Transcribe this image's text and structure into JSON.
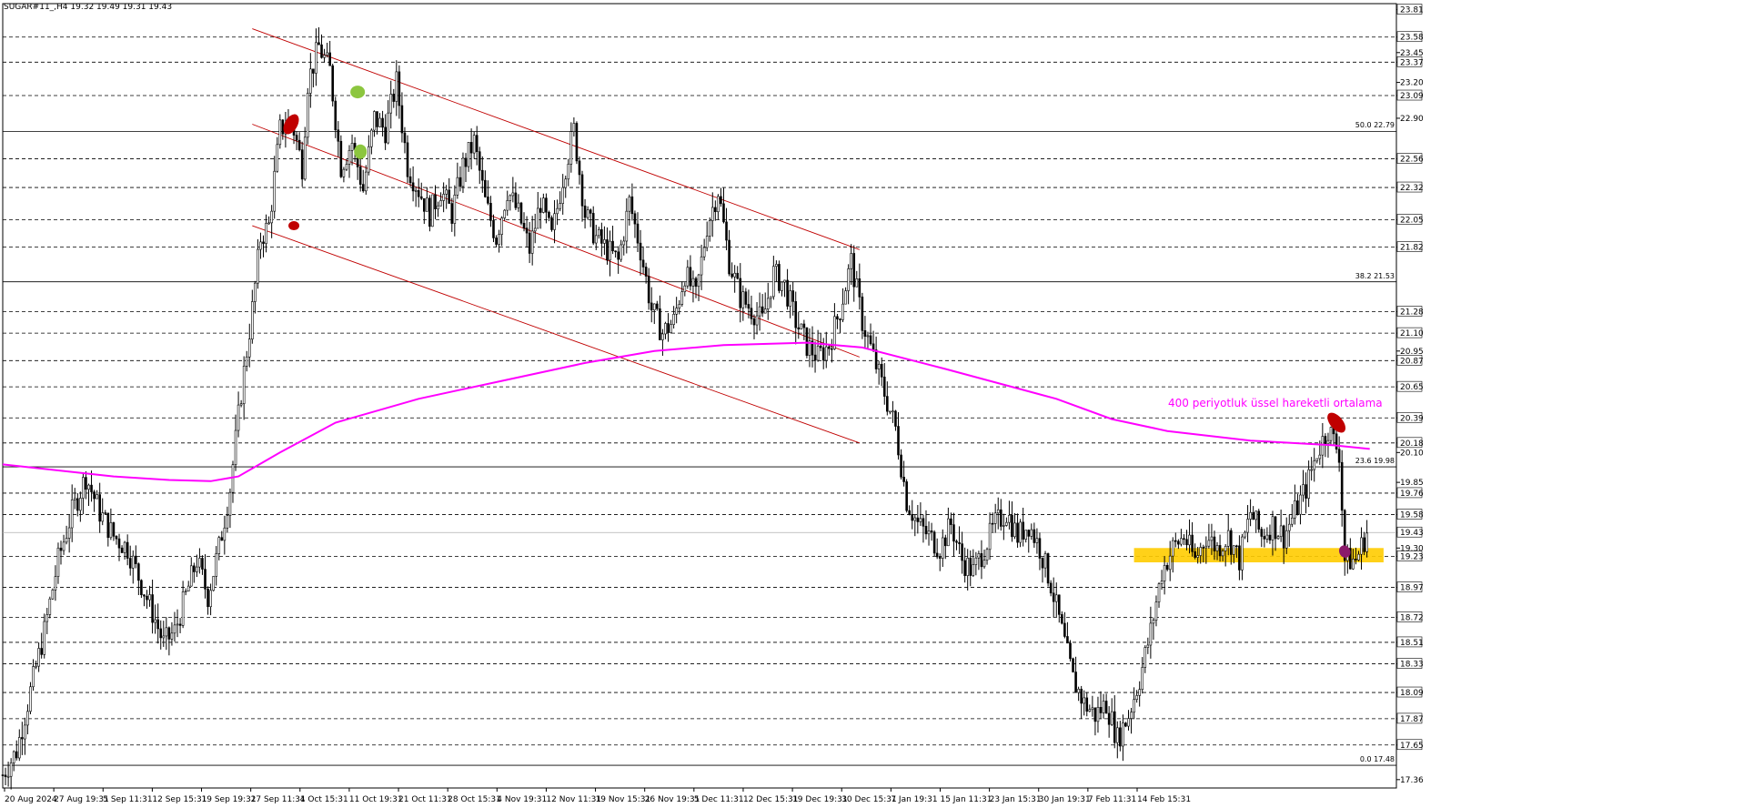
{
  "header": {
    "symbol": "SUGAR#11_,H4",
    "quote": "19.32 19.49 19.31 19.43"
  },
  "annotation": {
    "ma_caption": "400 periyotluk üssel hareketli ortalama"
  },
  "colors": {
    "candle": "#000000",
    "ma": "#ff00ff",
    "channel": "#c00000",
    "zone": "#ffcc00",
    "marker_red": "#c00000",
    "marker_green": "#8cc63f",
    "marker_purple": "#8b1a6b"
  },
  "chart_data": {
    "type": "candlestick",
    "title": "",
    "xlabel": "",
    "ylabel": "",
    "ylim": [
      17.29,
      23.86
    ],
    "grid": false,
    "price_levels": [
      {
        "value": 23.81,
        "label": "23.81",
        "boxed": true
      },
      {
        "value": 23.58,
        "label": "23.58",
        "boxed": true
      },
      {
        "value": 23.45,
        "label": "23.45",
        "boxed": false
      },
      {
        "value": 23.37,
        "label": "23.37",
        "boxed": true
      },
      {
        "value": 23.2,
        "label": "23.20",
        "boxed": false
      },
      {
        "value": 23.09,
        "label": "23.09",
        "boxed": true
      },
      {
        "value": 22.9,
        "label": "22.90",
        "boxed": false
      },
      {
        "value": 22.56,
        "label": "22.56",
        "boxed": true
      },
      {
        "value": 22.32,
        "label": "22.32",
        "boxed": true
      },
      {
        "value": 22.05,
        "label": "22.05",
        "boxed": true
      },
      {
        "value": 21.82,
        "label": "21.82",
        "boxed": true
      },
      {
        "value": 21.28,
        "label": "21.28",
        "boxed": true
      },
      {
        "value": 21.1,
        "label": "21.10",
        "boxed": true
      },
      {
        "value": 20.95,
        "label": "20.95",
        "boxed": false
      },
      {
        "value": 20.87,
        "label": "20.87",
        "boxed": true
      },
      {
        "value": 20.65,
        "label": "20.65",
        "boxed": true
      },
      {
        "value": 20.39,
        "label": "20.39",
        "boxed": true
      },
      {
        "value": 20.18,
        "label": "20.18",
        "boxed": true
      },
      {
        "value": 20.1,
        "label": "20.10",
        "boxed": false
      },
      {
        "value": 19.85,
        "label": "19.85",
        "boxed": false
      },
      {
        "value": 19.76,
        "label": "19.76",
        "boxed": true
      },
      {
        "value": 19.58,
        "label": "19.58",
        "boxed": true
      },
      {
        "value": 19.43,
        "label": "19.43",
        "boxed": true
      },
      {
        "value": 19.3,
        "label": "19.30",
        "boxed": false
      },
      {
        "value": 19.23,
        "label": "19.23",
        "boxed": true
      },
      {
        "value": 18.97,
        "label": "18.97",
        "boxed": true
      },
      {
        "value": 18.72,
        "label": "18.72",
        "boxed": true
      },
      {
        "value": 18.51,
        "label": "18.51",
        "boxed": true
      },
      {
        "value": 18.33,
        "label": "18.33",
        "boxed": true
      },
      {
        "value": 18.09,
        "label": "18.09",
        "boxed": true
      },
      {
        "value": 17.87,
        "label": "17.87",
        "boxed": true
      },
      {
        "value": 17.65,
        "label": "17.65",
        "boxed": true
      },
      {
        "value": 17.36,
        "label": "17.36",
        "boxed": false
      }
    ],
    "dashed_levels": [
      23.58,
      23.37,
      23.09,
      22.56,
      22.32,
      22.05,
      21.82,
      21.28,
      21.1,
      20.87,
      20.65,
      20.39,
      20.18,
      19.76,
      19.58,
      19.23,
      18.97,
      18.72,
      18.51,
      18.33,
      18.09,
      17.87,
      17.65
    ],
    "fibonacci": [
      {
        "label": "50.0 22.79",
        "value": 22.79
      },
      {
        "label": "38.2 21.53",
        "value": 21.53
      },
      {
        "label": "23.6 19.98",
        "value": 19.98
      },
      {
        "label": "0.0 17.48",
        "value": 17.48
      }
    ],
    "current_price": 19.43,
    "time_labels": [
      "20 Aug 2024",
      "27 Aug 19:31",
      "5 Sep 11:31",
      "12 Sep 15:31",
      "19 Sep 19:31",
      "27 Sep 11:31",
      "4 Oct 15:31",
      "11 Oct 19:31",
      "21 Oct 11:31",
      "28 Oct 15:31",
      "4 Nov 19:31",
      "12 Nov 11:31",
      "19 Nov 15:31",
      "26 Nov 19:31",
      "5 Dec 11:31",
      "12 Dec 15:31",
      "19 Dec 19:31",
      "30 Dec 15:31",
      "7 Jan 19:31",
      "15 Jan 11:31",
      "23 Jan 15:31",
      "30 Jan 19:31",
      "7 Feb 11:31",
      "14 Feb 15:31"
    ],
    "price_path": [
      [
        0,
        17.4
      ],
      [
        5,
        17.6
      ],
      [
        10,
        18.1
      ],
      [
        15,
        18.6
      ],
      [
        20,
        19.2
      ],
      [
        25,
        19.6
      ],
      [
        30,
        19.9
      ],
      [
        35,
        19.6
      ],
      [
        40,
        19.4
      ],
      [
        45,
        19.3
      ],
      [
        50,
        19.0
      ],
      [
        55,
        18.7
      ],
      [
        58,
        18.5
      ],
      [
        62,
        18.6
      ],
      [
        66,
        18.9
      ],
      [
        70,
        19.2
      ],
      [
        74,
        18.9
      ],
      [
        78,
        19.3
      ],
      [
        82,
        19.8
      ],
      [
        86,
        20.6
      ],
      [
        90,
        21.3
      ],
      [
        93,
        21.9
      ],
      [
        96,
        22.0
      ],
      [
        100,
        22.8
      ],
      [
        104,
        22.9
      ],
      [
        108,
        22.5
      ],
      [
        110,
        23.2
      ],
      [
        114,
        23.5
      ],
      [
        118,
        23.3
      ],
      [
        122,
        22.5
      ],
      [
        126,
        22.7
      ],
      [
        130,
        22.3
      ],
      [
        134,
        22.9
      ],
      [
        138,
        22.8
      ],
      [
        142,
        23.2
      ],
      [
        146,
        22.5
      ],
      [
        150,
        22.3
      ],
      [
        154,
        22.1
      ],
      [
        158,
        22.3
      ],
      [
        162,
        22.1
      ],
      [
        166,
        22.5
      ],
      [
        170,
        22.7
      ],
      [
        174,
        22.2
      ],
      [
        178,
        21.9
      ],
      [
        182,
        22.3
      ],
      [
        186,
        22.1
      ],
      [
        190,
        21.8
      ],
      [
        194,
        22.2
      ],
      [
        198,
        21.9
      ],
      [
        202,
        22.4
      ],
      [
        206,
        22.8
      ],
      [
        210,
        22.1
      ],
      [
        214,
        21.9
      ],
      [
        218,
        21.8
      ],
      [
        222,
        21.7
      ],
      [
        226,
        22.2
      ],
      [
        230,
        21.8
      ],
      [
        234,
        21.3
      ],
      [
        238,
        21.1
      ],
      [
        242,
        21.2
      ],
      [
        246,
        21.6
      ],
      [
        250,
        21.4
      ],
      [
        254,
        22.0
      ],
      [
        258,
        22.3
      ],
      [
        262,
        21.7
      ],
      [
        266,
        21.4
      ],
      [
        270,
        21.3
      ],
      [
        274,
        21.2
      ],
      [
        278,
        21.6
      ],
      [
        282,
        21.5
      ],
      [
        286,
        21.2
      ],
      [
        290,
        21.0
      ],
      [
        294,
        20.9
      ],
      [
        298,
        21.0
      ],
      [
        302,
        21.3
      ],
      [
        306,
        21.7
      ],
      [
        310,
        21.2
      ],
      [
        314,
        20.9
      ],
      [
        318,
        20.6
      ],
      [
        322,
        20.3
      ],
      [
        326,
        19.7
      ],
      [
        330,
        19.5
      ],
      [
        334,
        19.4
      ],
      [
        338,
        19.3
      ],
      [
        342,
        19.5
      ],
      [
        346,
        19.2
      ],
      [
        350,
        19.1
      ],
      [
        354,
        19.3
      ],
      [
        358,
        19.5
      ],
      [
        362,
        19.6
      ],
      [
        366,
        19.4
      ],
      [
        370,
        19.5
      ],
      [
        374,
        19.3
      ],
      [
        378,
        19.0
      ],
      [
        382,
        18.6
      ],
      [
        386,
        18.2
      ],
      [
        390,
        18.0
      ],
      [
        394,
        17.9
      ],
      [
        398,
        18.0
      ],
      [
        402,
        17.7
      ],
      [
        406,
        17.9
      ],
      [
        410,
        18.2
      ],
      [
        414,
        18.6
      ],
      [
        418,
        19.1
      ],
      [
        422,
        19.3
      ],
      [
        426,
        19.4
      ],
      [
        430,
        19.2
      ],
      [
        434,
        19.4
      ],
      [
        438,
        19.3
      ],
      [
        442,
        19.4
      ],
      [
        446,
        19.2
      ],
      [
        450,
        19.6
      ],
      [
        454,
        19.4
      ],
      [
        458,
        19.5
      ],
      [
        462,
        19.4
      ],
      [
        466,
        19.6
      ],
      [
        470,
        19.8
      ],
      [
        474,
        20.1
      ],
      [
        478,
        20.3
      ],
      [
        482,
        20.1
      ],
      [
        484,
        19.2
      ],
      [
        488,
        19.2
      ],
      [
        492,
        19.43
      ]
    ],
    "ema400": [
      [
        0,
        20.0
      ],
      [
        20,
        19.95
      ],
      [
        40,
        19.9
      ],
      [
        60,
        19.87
      ],
      [
        75,
        19.86
      ],
      [
        85,
        19.9
      ],
      [
        100,
        20.1
      ],
      [
        120,
        20.35
      ],
      [
        150,
        20.55
      ],
      [
        180,
        20.7
      ],
      [
        210,
        20.85
      ],
      [
        235,
        20.95
      ],
      [
        260,
        21.0
      ],
      [
        290,
        21.02
      ],
      [
        310,
        20.98
      ],
      [
        340,
        20.8
      ],
      [
        380,
        20.55
      ],
      [
        400,
        20.38
      ],
      [
        420,
        20.28
      ],
      [
        450,
        20.2
      ],
      [
        480,
        20.16
      ],
      [
        493,
        20.13
      ]
    ],
    "channel_lines": [
      {
        "from": [
          90,
          23.65
        ],
        "to": [
          309,
          21.8
        ]
      },
      {
        "from": [
          90,
          22.85
        ],
        "to": [
          309,
          20.9
        ]
      },
      {
        "from": [
          90,
          22.0
        ],
        "to": [
          309,
          20.18
        ]
      }
    ],
    "support_zone": {
      "from_bar": 408,
      "to_bar": 498,
      "low": 19.18,
      "high": 19.3
    }
  }
}
